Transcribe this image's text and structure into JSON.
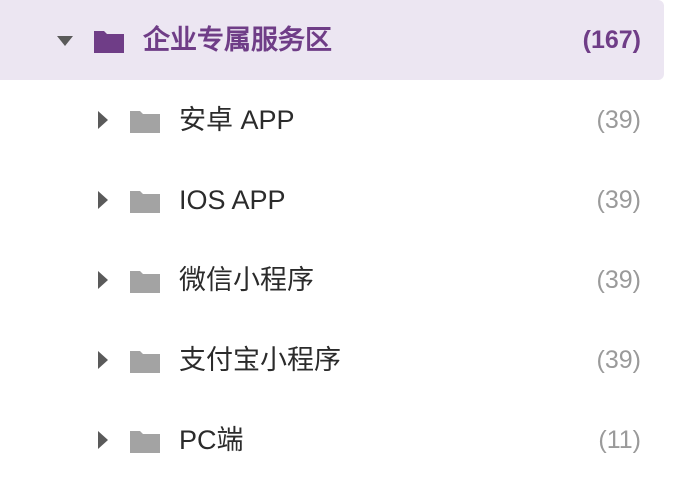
{
  "colors": {
    "accent": "#6f3d87",
    "selected_background": "#ece6f2",
    "child_folder": "#a3a3a3",
    "child_text": "#2b2b2b",
    "count_text": "#9a9a9a"
  },
  "tree": {
    "parent": {
      "label": "企业专属服务区",
      "count": "(167)",
      "expanded": true,
      "icon": "folder-icon"
    },
    "children": [
      {
        "label": "安卓 APP",
        "count": "(39)",
        "expanded": false,
        "icon": "folder-icon"
      },
      {
        "label": "IOS APP",
        "count": "(39)",
        "expanded": false,
        "icon": "folder-icon"
      },
      {
        "label": "微信小程序",
        "count": "(39)",
        "expanded": false,
        "icon": "folder-icon"
      },
      {
        "label": "支付宝小程序",
        "count": "(39)",
        "expanded": false,
        "icon": "folder-icon"
      },
      {
        "label": "PC端",
        "count": "(11)",
        "expanded": false,
        "icon": "folder-icon"
      }
    ]
  }
}
